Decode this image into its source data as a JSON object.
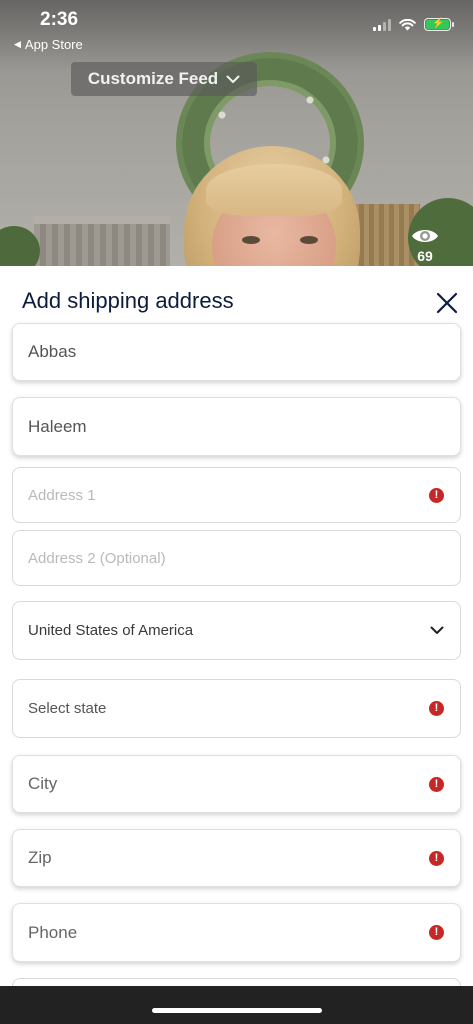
{
  "status_bar": {
    "time": "2:36",
    "back_label": "App Store",
    "battery_color": "#34c759"
  },
  "video": {
    "customize_feed_label": "Customize Feed",
    "view_count": "69"
  },
  "sheet": {
    "title": "Add shipping address",
    "close_icon": "close-icon",
    "fields": {
      "first_name": {
        "value": "Abbas"
      },
      "last_name": {
        "value": "Haleem"
      },
      "address1": {
        "placeholder": "Address 1",
        "error": true
      },
      "address2": {
        "placeholder": "Address 2 (Optional)"
      },
      "country": {
        "value": "United States of America"
      },
      "state": {
        "placeholder": "Select state",
        "error": true
      },
      "city": {
        "placeholder": "City",
        "error": true
      },
      "zip": {
        "placeholder": "Zip",
        "error": true
      },
      "phone": {
        "placeholder": "Phone",
        "error": true
      }
    },
    "error_color": "#c62828",
    "title_color": "#0d1b3e"
  }
}
